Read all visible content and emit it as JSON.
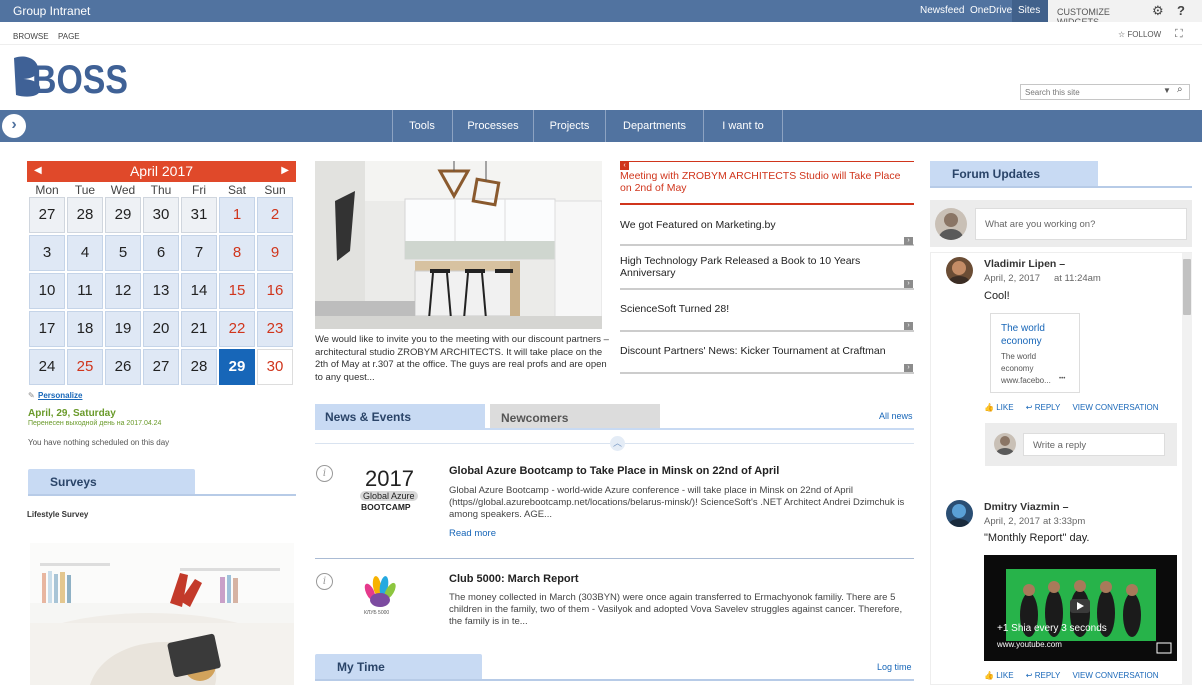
{
  "suitebar": {
    "title": "Group Intranet",
    "links": [
      "Newsfeed",
      "OneDrive",
      "Sites"
    ],
    "customize": "CUSTOMIZE WIDGETS"
  },
  "ribbon": {
    "tabs": [
      "BROWSE",
      "PAGE"
    ],
    "follow": "FOLLOW"
  },
  "search": {
    "placeholder": "Search this site"
  },
  "nav": [
    "Tools",
    "Processes",
    "Projects",
    "Departments",
    "I want to"
  ],
  "calendar": {
    "month": "April 2017",
    "weekdays": [
      "Mon",
      "Tue",
      "Wed",
      "Thu",
      "Fri",
      "Sat",
      "Sun"
    ],
    "weeks": [
      [
        "27",
        "28",
        "29",
        "30",
        "31",
        "1",
        "2"
      ],
      [
        "3",
        "4",
        "5",
        "6",
        "7",
        "8",
        "9"
      ],
      [
        "10",
        "11",
        "12",
        "13",
        "14",
        "15",
        "16"
      ],
      [
        "17",
        "18",
        "19",
        "20",
        "21",
        "22",
        "23"
      ],
      [
        "24",
        "25",
        "26",
        "27",
        "28",
        "29",
        "30"
      ]
    ],
    "today": "29",
    "personalize": "Personalize",
    "selected_day": "April, 29, Saturday",
    "selected_sub": "Перенесен выходной день на 2017.04.24",
    "nothing": "You have nothing scheduled on this day"
  },
  "surveys": {
    "title": "Surveys",
    "subtitle": "Lifestyle Survey"
  },
  "hero": {
    "caption": "We would like to invite you to the meeting with our discount partners – architectural studio ZROBYM ARCHITECTS. It will take place on the 2th of May at r.307 at the office. The guys are real profs and are open to any quest..."
  },
  "headlines": [
    "Meeting with ZROBYM ARCHITECTS Studio will Take Place on 2nd of May",
    "We got Featured on Marketing.by",
    "High Technology Park Released a Book to 10 Years Anniversary",
    "ScienceSoft Turned 28!",
    "Discount Partners' News: Kicker Tournament at Craftman"
  ],
  "tabs": {
    "news": "News & Events",
    "newcomers": "Newcomers",
    "all": "All news"
  },
  "news": [
    {
      "title": "Global Azure Bootcamp to Take Place in Minsk on 22nd of April",
      "body": "Global Azure Bootcamp - world-wide Azure conference - will take place in Minsk on 22nd of April (https//global.azurebootcamp.net/locations/belarus-minsk/)! ScienceSoft's .NET Architect Andrei Dzimchuk is among speakers. AGE...",
      "more": "Read more",
      "logo_year": "2017",
      "logo_line1": "Global Azure",
      "logo_line2": "BOOTCAMP"
    },
    {
      "title": "Club 5000: March Report",
      "body": "The money collected in March (303BYN) were once again transferred to Ermachyonok familiy. There are 5 children in the family, two of them - Vasilyok and adopted Vova Savelev struggles against cancer. Therefore, the family is in te...",
      "logo_text": "КЛУБ 5000"
    }
  ],
  "mytime": {
    "title": "My Time",
    "link": "Log time"
  },
  "forum": {
    "title": "Forum Updates",
    "composer": "What are you working on?",
    "posts": [
      {
        "name": "Vladimir Lipen –",
        "date": "April, 2, 2017",
        "time": "at 11:24am",
        "msg": "Cool!",
        "card_title": "The world economy",
        "card_desc": "The world economy",
        "card_url": "www.facebo...",
        "card_more": "•••"
      },
      {
        "name": "Dmitry Viazmin –",
        "date": "April, 2, 2017",
        "time": "at 3:33pm",
        "msg": "\"Monthly Report\" day.",
        "video_caption": "+1 Shia every 3 seconds",
        "video_source": "www.youtube.com"
      }
    ],
    "like": "LIKE",
    "reply": "REPLY",
    "view": "VIEW CONVERSATION",
    "reply_placeholder": "Write a reply"
  },
  "colors": {
    "brand": "#5173a0",
    "accent_red": "#d0351c",
    "today": "#1766b8",
    "tab_blue": "#c8daf3"
  }
}
